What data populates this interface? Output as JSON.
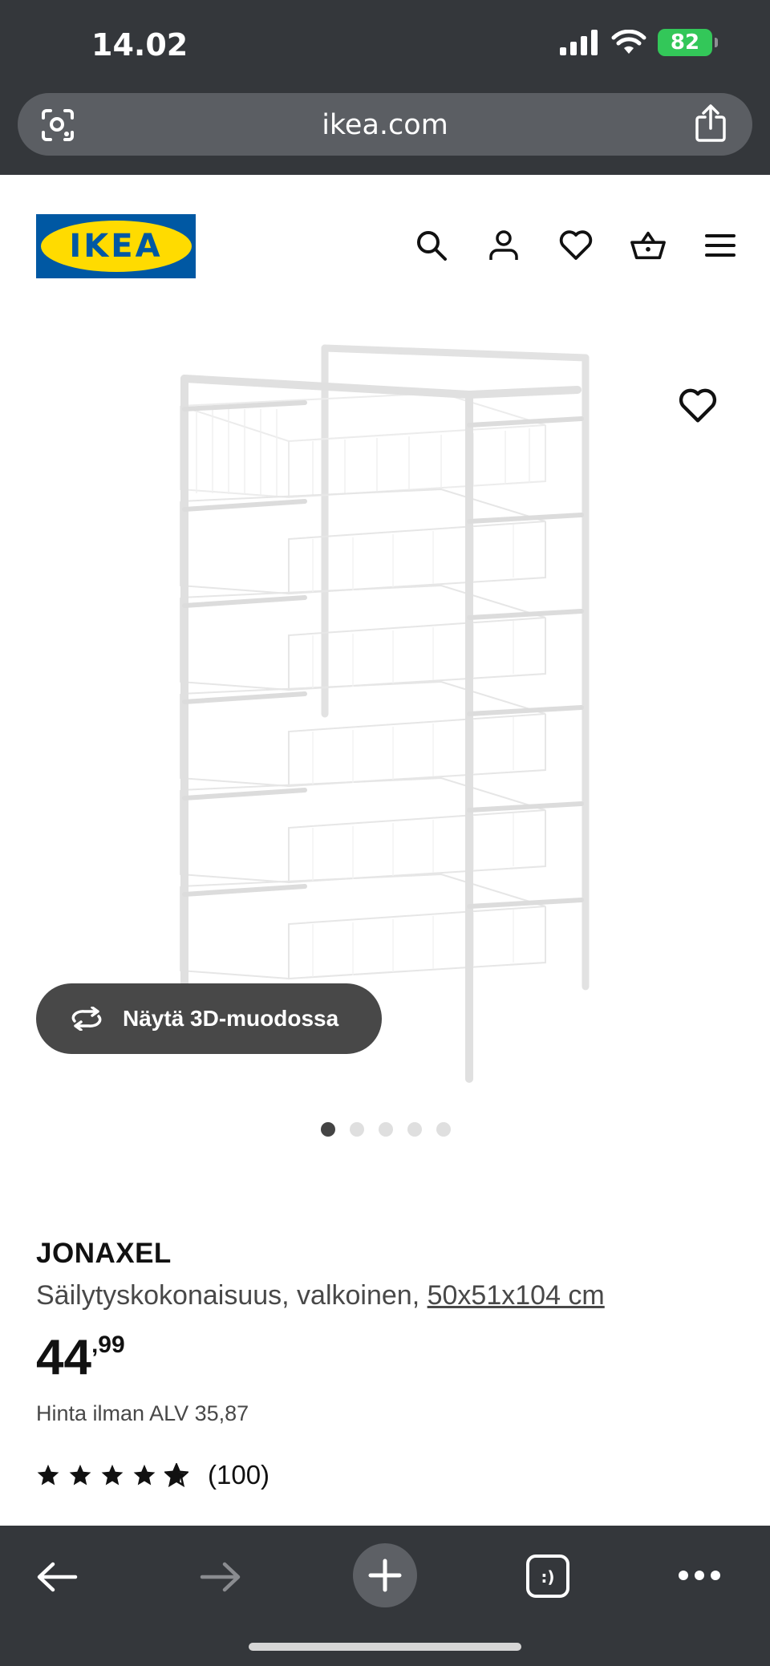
{
  "status_bar": {
    "time": "14.02",
    "battery": "82"
  },
  "browser": {
    "url": "ikea.com"
  },
  "header": {
    "logo_text": "IKEA",
    "brand_blue": "#0058a3",
    "brand_yellow": "#ffdb00"
  },
  "gallery": {
    "view_3d_label": "Näytä 3D-muodossa",
    "dots_total": 5,
    "active_dot": 1
  },
  "product": {
    "name": "JONAXEL",
    "description": "Säilytyskokonaisuus, valkoinen,",
    "size": "50x51x104 cm",
    "price_int": "44",
    "price_dec": ",99",
    "vat_text": "Hinta ilman ALV 35,87",
    "rating_stars": 4.5,
    "rating_count": "(100)"
  },
  "icons": [
    "lens-icon",
    "share-icon",
    "search-icon",
    "profile-icon",
    "heart-icon",
    "cart-icon",
    "menu-icon",
    "rotate-3d-icon",
    "back-icon",
    "forward-icon",
    "plus-icon",
    "tabs-icon",
    "more-icon"
  ]
}
